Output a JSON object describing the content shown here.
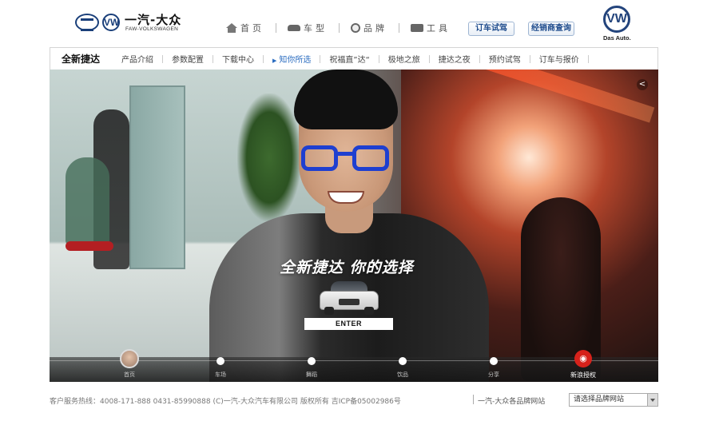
{
  "header": {
    "brand_name": "一汽-大众",
    "brand_sub": "FAW-VOLKSWAGEN",
    "vw_logo_text": "VW",
    "das_auto": "Das Auto.",
    "nav": [
      {
        "label": "首页",
        "icon": "home-icon"
      },
      {
        "label": "车型",
        "icon": "car-icon"
      },
      {
        "label": "品牌",
        "icon": "globe-icon"
      },
      {
        "label": "工具",
        "icon": "toolbox-icon"
      }
    ],
    "testdrive_button": "订车试驾",
    "dealer_button": "经销商查询"
  },
  "subnav": {
    "title": "全新捷达",
    "tabs": [
      "产品介绍",
      "参数配置",
      "下载中心",
      "知你所选",
      "祝福直”达“",
      "极地之旅",
      "捷达之夜",
      "预约试驾",
      "订车与报价"
    ],
    "active_index": 3
  },
  "hero": {
    "tagline": "全新捷达 你的选择",
    "enter_button": "ENTER",
    "share_icon": "share-icon",
    "timeline": [
      {
        "label": "首页",
        "type": "avatar"
      },
      {
        "label": "车场",
        "type": "dot"
      },
      {
        "label": "舞蹈",
        "type": "dot"
      },
      {
        "label": "饮品",
        "type": "dot"
      },
      {
        "label": "分享",
        "type": "dot"
      },
      {
        "label": "新浪授权",
        "type": "weibo"
      }
    ]
  },
  "footer": {
    "info": "客户服务热线：4008-171-888    0431-85990888  (C)一汽-大众汽车有限公司  版权所有  吉ICP备05002986号",
    "brands_label": "一汽-大众各品牌网站",
    "select_value": "请选择品牌网站"
  },
  "colors": {
    "accent": "#2a6cc0",
    "brand_blue": "#23447c",
    "glasses_blue": "#1e3fd0",
    "weibo_red": "#d6221b"
  }
}
